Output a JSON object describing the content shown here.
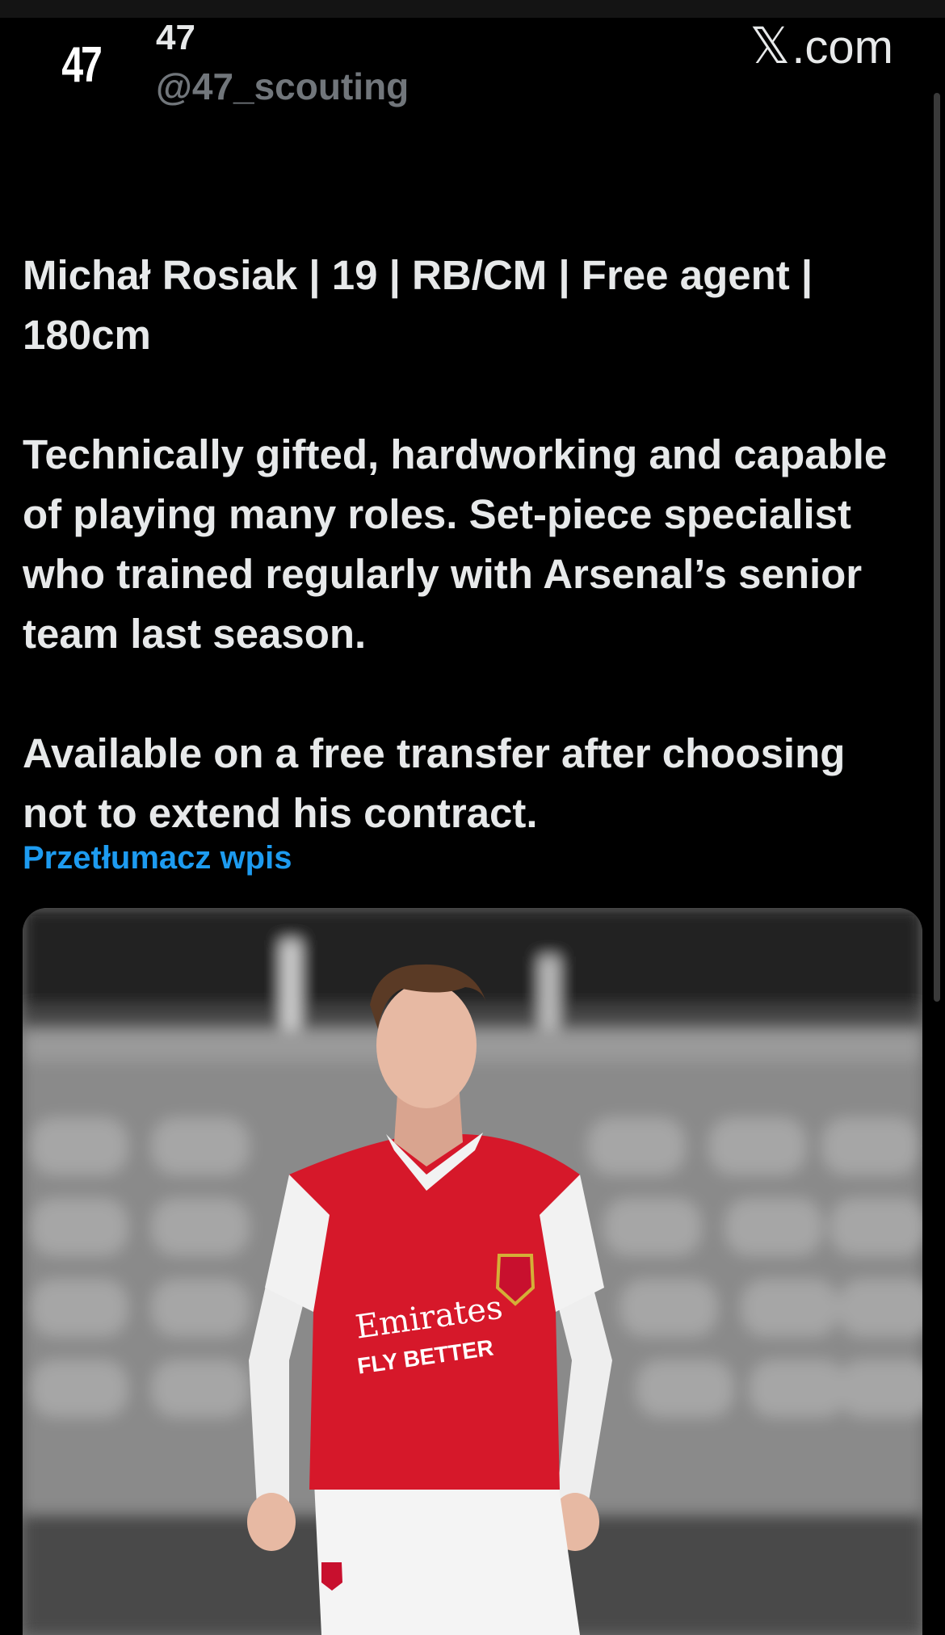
{
  "header": {
    "avatar_text": "47",
    "display_name": "47",
    "handle": "@47_scouting",
    "brand": ".com"
  },
  "tweet": {
    "flag": "poland-flag-icon",
    "line1": "Michał Rosiak | 19 | RB/CM | Free agent | 180cm",
    "paragraph2": "Technically gifted, hardworking and capable of playing many roles. Set-piece specialist who trained regularly with Arsenal’s senior team last season.",
    "paragraph3": "Available on a free transfer after choosing not to extend his contract."
  },
  "translate_link": "Przetłumacz wpis",
  "media": {
    "shirt_sponsor": "Emirates",
    "shirt_tagline": "FLY BETTER"
  },
  "colors": {
    "background": "#000000",
    "text": "#e7e9ea",
    "muted": "#71767b",
    "link": "#1d9bf0",
    "shirt_red": "#d6182a"
  }
}
